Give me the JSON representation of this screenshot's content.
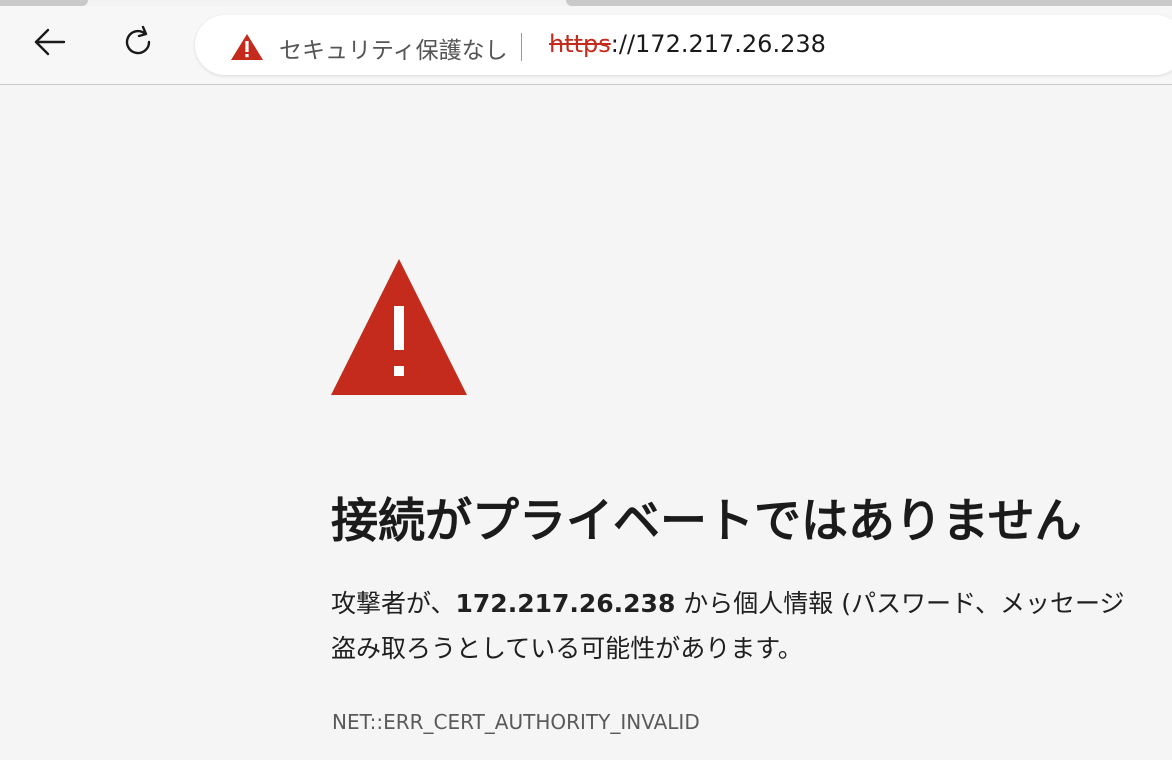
{
  "browser": {
    "address_bar": {
      "security_label": "セキュリティ保護なし",
      "url_scheme": "https",
      "url_rest": "://172.217.26.238"
    },
    "icons": {
      "back": "back-arrow-icon",
      "reload": "reload-icon",
      "security": "warning-triangle-icon"
    }
  },
  "error_page": {
    "heading": "接続がプライベートではありません",
    "description_prefix": "攻撃者が、",
    "description_host": "172.217.26.238",
    "description_suffix": " から個人情報 (パスワード、メッセージ",
    "description_line2": "盗み取ろうとしている可能性があります。",
    "error_code": "NET::ERR_CERT_AUTHORITY_INVALID"
  },
  "colors": {
    "warning_red": "#c42b1c",
    "page_background": "#f5f5f5",
    "text": "#1b1b1b"
  }
}
